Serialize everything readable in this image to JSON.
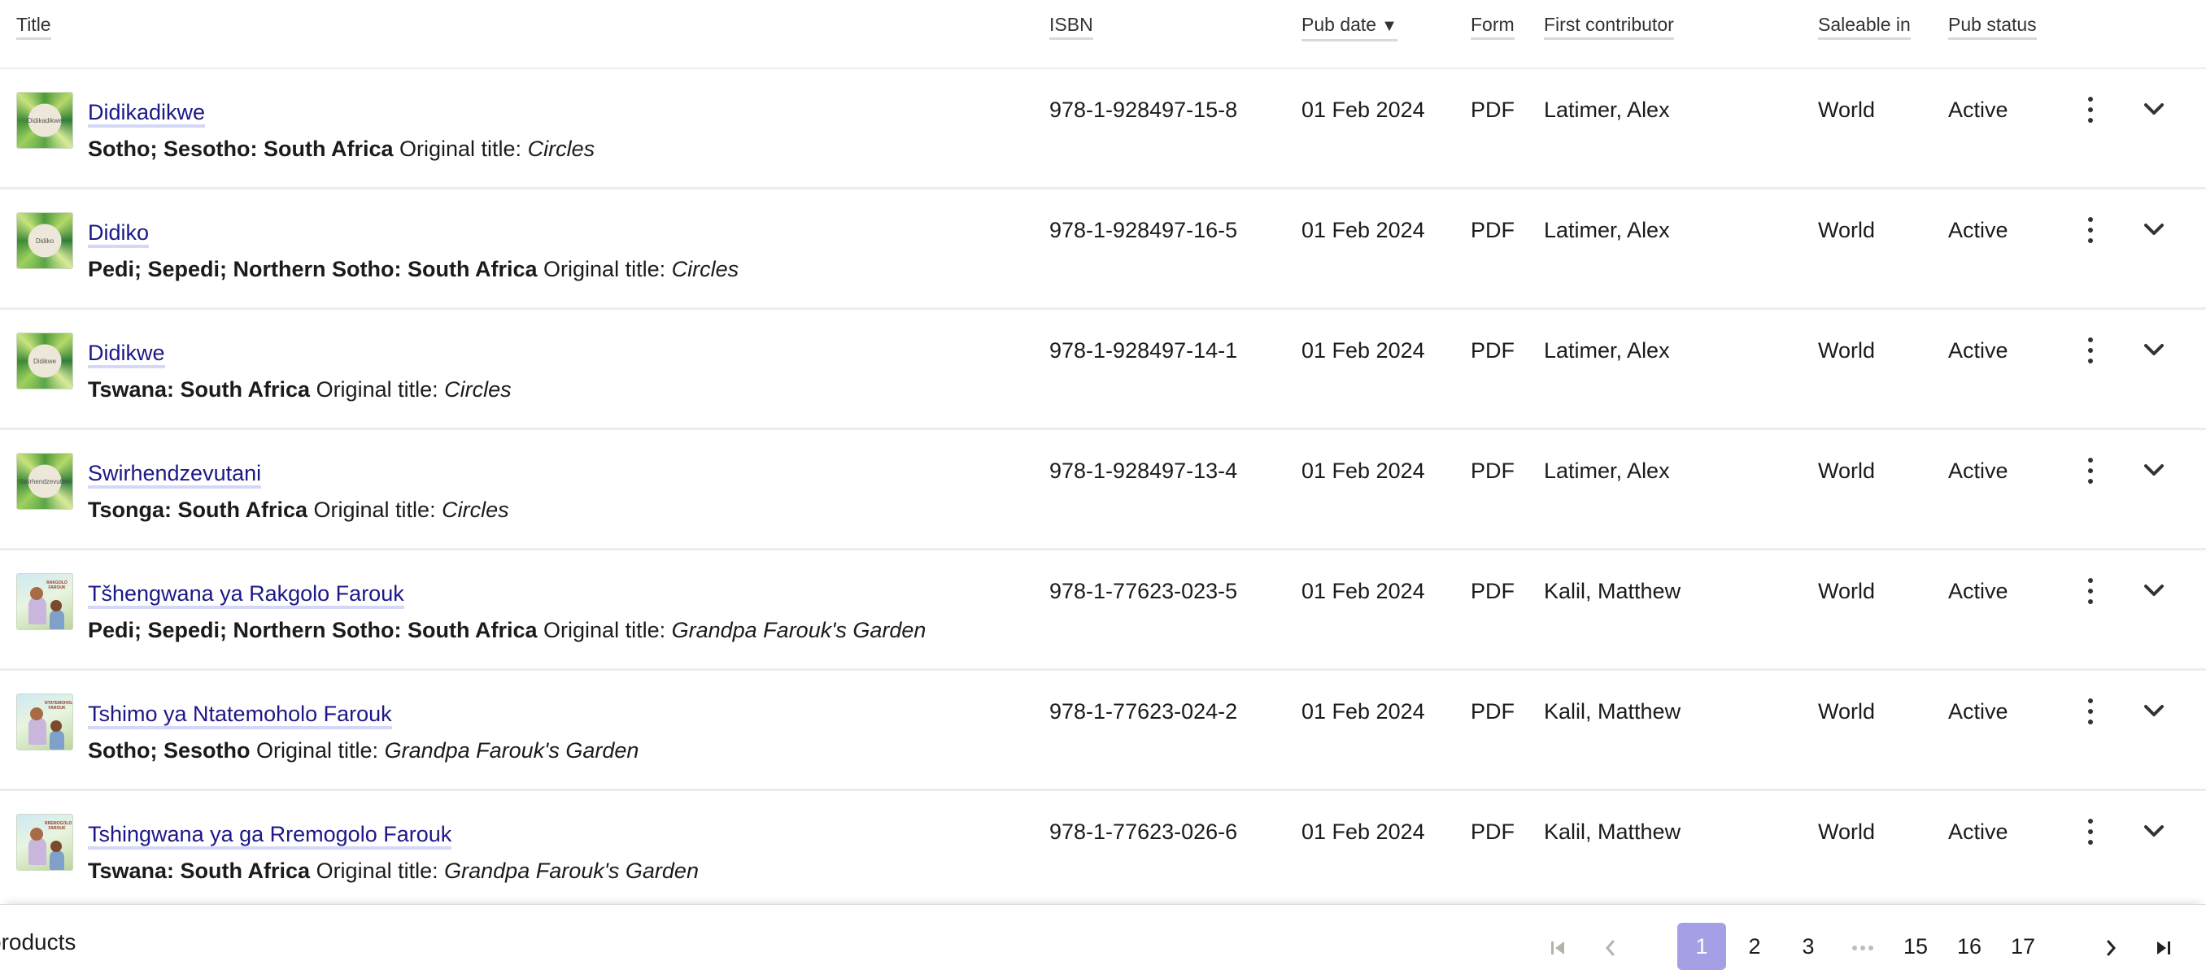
{
  "columns": {
    "title": "Title",
    "isbn": "ISBN",
    "pub_date": "Pub date",
    "pub_date_sort": "▼",
    "form": "Form",
    "first_contributor": "First contributor",
    "saleable_in": "Saleable in",
    "pub_status": "Pub status"
  },
  "rows": [
    {
      "cover": "circles",
      "cover_text": "Didikadikwe",
      "title": "Didikadikwe",
      "language": "Sotho; Sesotho: South Africa",
      "orig_label": "Original title:",
      "orig_title": "Circles",
      "isbn": "978-1-928497-15-8",
      "pub_date": "01 Feb 2024",
      "form": "PDF",
      "contributor": "Latimer, Alex",
      "saleable": "World",
      "status": "Active"
    },
    {
      "cover": "circles",
      "cover_text": "Didiko",
      "title": "Didiko",
      "language": "Pedi; Sepedi; Northern Sotho: South Africa",
      "orig_label": "Original title:",
      "orig_title": "Circles",
      "isbn": "978-1-928497-16-5",
      "pub_date": "01 Feb 2024",
      "form": "PDF",
      "contributor": "Latimer, Alex",
      "saleable": "World",
      "status": "Active"
    },
    {
      "cover": "circles",
      "cover_text": "Didikwe",
      "title": "Didikwe",
      "language": "Tswana: South Africa",
      "orig_label": "Original title:",
      "orig_title": "Circles",
      "isbn": "978-1-928497-14-1",
      "pub_date": "01 Feb 2024",
      "form": "PDF",
      "contributor": "Latimer, Alex",
      "saleable": "World",
      "status": "Active"
    },
    {
      "cover": "circles",
      "cover_text": "Swirhendzevutani",
      "title": "Swirhendzevutani",
      "language": "Tsonga: South Africa",
      "orig_label": "Original title:",
      "orig_title": "Circles",
      "isbn": "978-1-928497-13-4",
      "pub_date": "01 Feb 2024",
      "form": "PDF",
      "contributor": "Latimer, Alex",
      "saleable": "World",
      "status": "Active"
    },
    {
      "cover": "farouk",
      "cover_text": "RAKGOLO FAROUK",
      "title": "Tšhengwana ya Rakgolo Farouk",
      "language": "Pedi; Sepedi; Northern Sotho: South Africa",
      "orig_label": "Original title:",
      "orig_title": "Grandpa Farouk's Garden",
      "isbn": "978-1-77623-023-5",
      "pub_date": "01 Feb 2024",
      "form": "PDF",
      "contributor": "Kalil, Matthew",
      "saleable": "World",
      "status": "Active"
    },
    {
      "cover": "farouk",
      "cover_text": "NTATEMOHOLO FAROUK",
      "title": "Tshimo ya Ntatemoholo Farouk",
      "language": "Sotho; Sesotho",
      "orig_label": "Original title:",
      "orig_title": "Grandpa Farouk's Garden",
      "isbn": "978-1-77623-024-2",
      "pub_date": "01 Feb 2024",
      "form": "PDF",
      "contributor": "Kalil, Matthew",
      "saleable": "World",
      "status": "Active"
    },
    {
      "cover": "farouk",
      "cover_text": "RREMOGOLO FAROUK",
      "title": "Tshingwana ya ga Rremogolo Farouk",
      "language": "Tswana: South Africa",
      "orig_label": "Original title:",
      "orig_title": "Grandpa Farouk's Garden",
      "isbn": "978-1-77623-026-6",
      "pub_date": "01 Feb 2024",
      "form": "PDF",
      "contributor": "Kalil, Matthew",
      "saleable": "World",
      "status": "Active"
    }
  ],
  "icons": {
    "row_menu": "kebab-menu-icon",
    "row_expand": "chevron-down-icon",
    "first_page": "first-page-icon",
    "prev_page": "chevron-left-icon",
    "ellipsis": "ellipsis-icon",
    "next_page": "chevron-right-icon",
    "last_page": "last-page-icon"
  },
  "footer": {
    "count_label": "products",
    "pages": [
      "1",
      "2",
      "3",
      "15",
      "16",
      "17"
    ],
    "current_page": "1"
  },
  "colors": {
    "link": "#1c1888",
    "link_underline": "#d4d8f8",
    "active_page": "#a5a0e6"
  }
}
